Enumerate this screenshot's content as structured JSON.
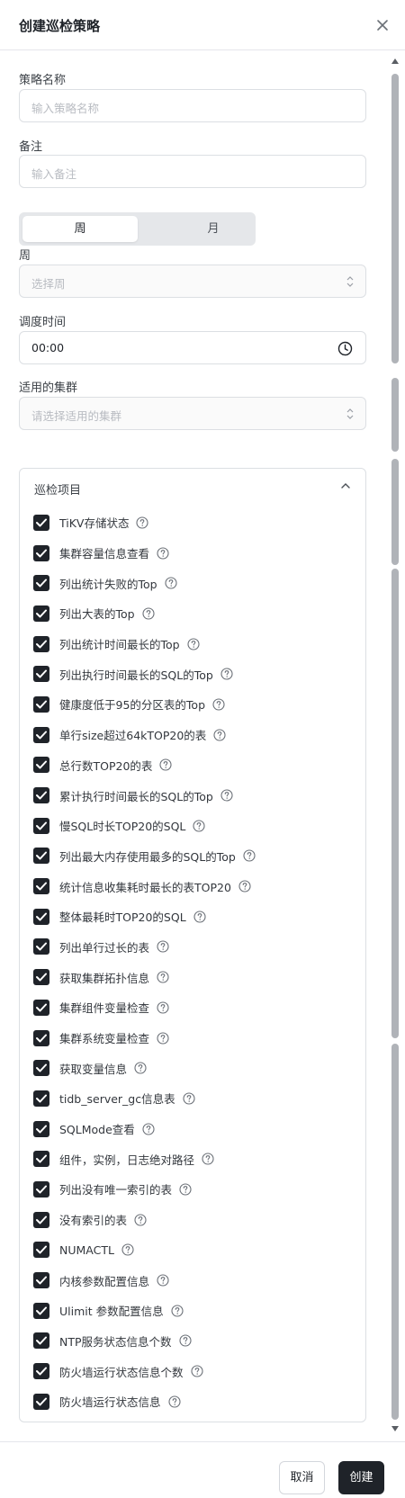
{
  "dialog": {
    "title": "创建巡检策略"
  },
  "form": {
    "name": {
      "label": "策略名称",
      "placeholder": "输入策略名称"
    },
    "remark": {
      "label": "备注",
      "placeholder": "输入备注"
    },
    "period_toggle": {
      "week": "周",
      "month": "月",
      "selected": "周"
    },
    "weekday": {
      "label": "周",
      "placeholder": "选择周"
    },
    "time": {
      "label": "调度时间",
      "value": "00:00"
    },
    "cluster": {
      "label": "适用的集群",
      "placeholder": "请选择适用的集群"
    }
  },
  "items_panel": {
    "title": "巡检项目",
    "items": [
      "TiKV存储状态",
      "集群容量信息查看",
      "列出统计失败的Top",
      "列出大表的Top",
      "列出统计时间最长的Top",
      "列出执行时间最长的SQL的Top",
      "健康度低于95的分区表的Top",
      "单行size超过64kTOP20的表",
      "总行数TOP20的表",
      "累计执行时间最长的SQL的Top",
      "慢SQL时长TOP20的SQL",
      "列出最大内存使用最多的SQL的Top",
      "统计信息收集耗时最长的表TOP20",
      "整体最耗时TOP20的SQL",
      "列出单行过长的表",
      "获取集群拓扑信息",
      "集群组件变量检查",
      "集群系统变量检查",
      "获取变量信息",
      "tidb_server_gc信息表",
      "SQLMode查看",
      "组件，实例，日志绝对路径",
      "列出没有唯一索引的表",
      "没有索引的表",
      "NUMACTL",
      "内核参数配置信息",
      "Ulimit 参数配置信息",
      "NTP服务状态信息个数",
      "防火墙运行状态信息个数",
      "防火墙运行状态信息"
    ]
  },
  "footer": {
    "cancel": "取消",
    "create": "创建"
  },
  "colors": {
    "primary": "#1f2329",
    "border": "#dcdfe3",
    "placeholder": "#b9bcc2",
    "toggle_bg": "#e5e7ea"
  },
  "icons": {
    "close": "close-icon",
    "help": "question-circle-icon",
    "clock": "clock-icon",
    "select": "chevron-updown-icon",
    "collapse": "chevron-up-icon",
    "check": "check-icon"
  }
}
